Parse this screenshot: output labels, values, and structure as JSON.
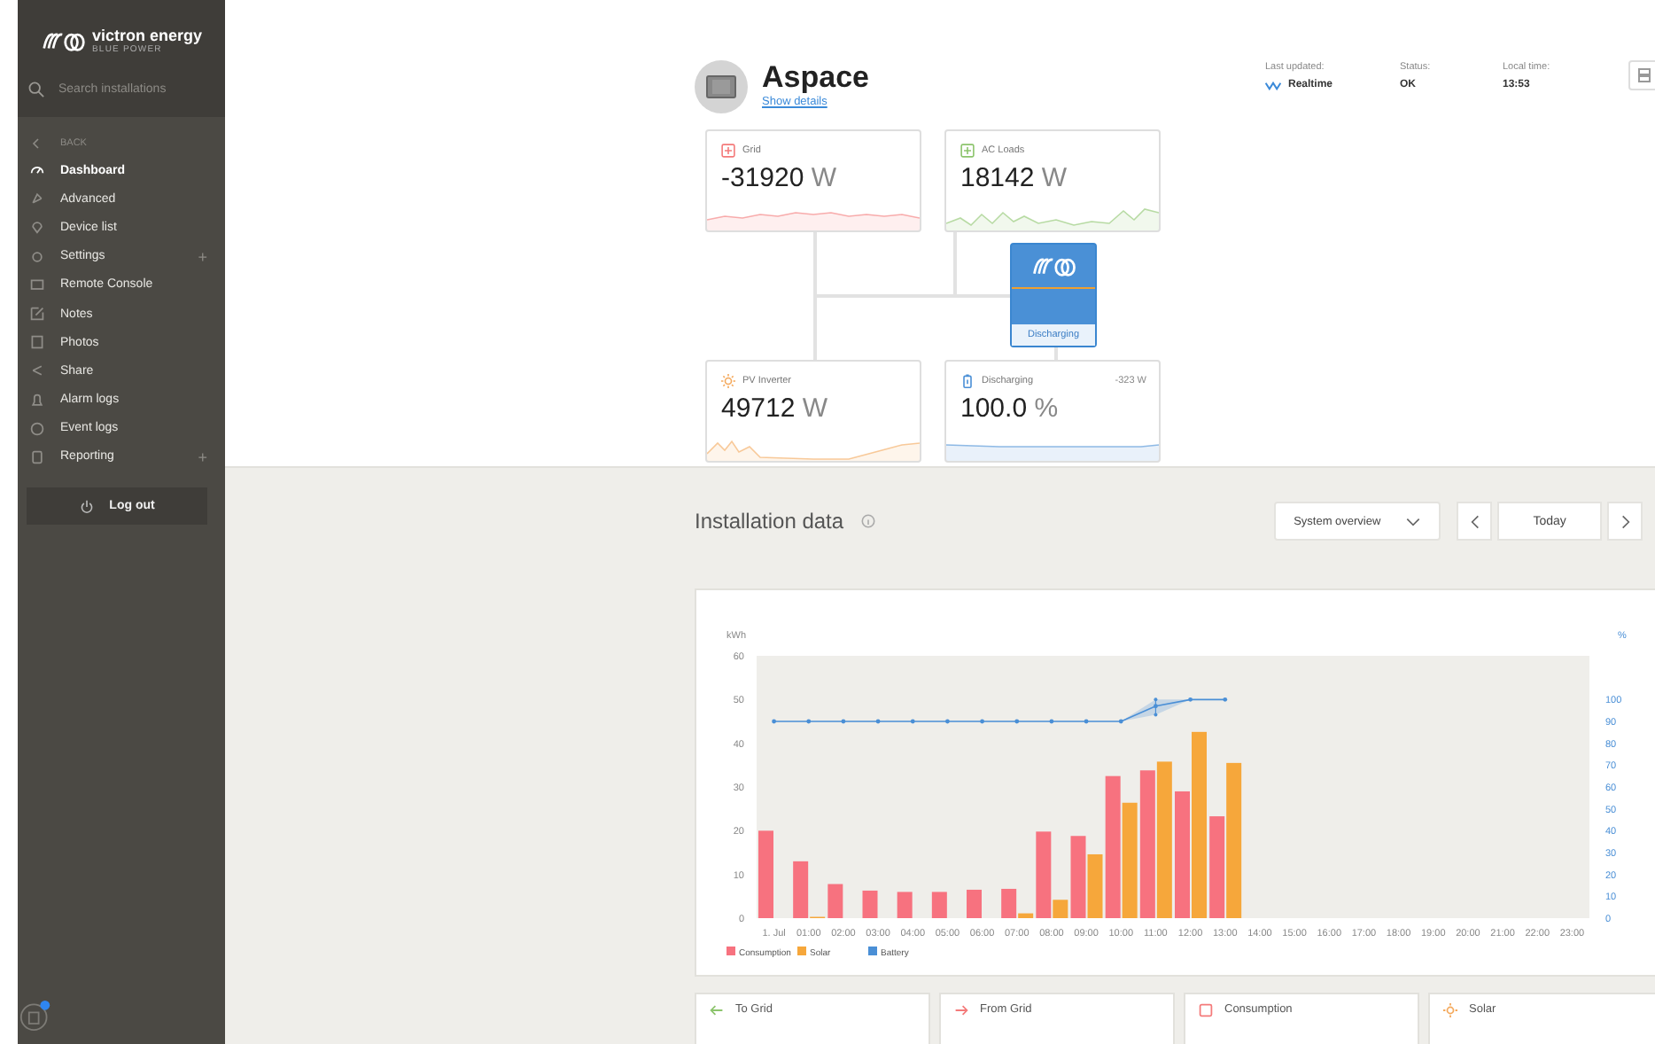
{
  "sidebar": {
    "logo": "victron energy",
    "tagline": "BLUE POWER",
    "search": {
      "placeholder": "Search installations"
    },
    "back": "BACK",
    "items": [
      {
        "label": "Dashboard",
        "selected": true,
        "expandable": false
      },
      {
        "label": "Advanced",
        "selected": false,
        "expandable": false
      },
      {
        "label": "Device list",
        "selected": false,
        "expandable": false
      },
      {
        "label": "Settings",
        "selected": false,
        "expandable": true
      },
      {
        "label": "Remote Console",
        "selected": false,
        "expandable": false
      },
      {
        "label": "Notes",
        "selected": false,
        "expandable": false
      },
      {
        "label": "Photos",
        "selected": false,
        "expandable": false
      },
      {
        "label": "Share",
        "selected": false,
        "expandable": false
      },
      {
        "label": "Alarm logs",
        "selected": false,
        "expandable": false
      },
      {
        "label": "Event logs",
        "selected": false,
        "expandable": false
      },
      {
        "label": "Reporting",
        "selected": false,
        "expandable": true
      }
    ],
    "expand_mark": "+",
    "logout": "Log out"
  },
  "header": {
    "title": "Aspace",
    "details_link": "Show details",
    "stats": [
      {
        "label": "Last updated:",
        "value": "Realtime",
        "live": true
      },
      {
        "label": "Status:",
        "value": "OK",
        "live": false
      },
      {
        "label": "Local time:",
        "value": "13:53",
        "live": false
      }
    ]
  },
  "flow": {
    "tiles": [
      {
        "kind": "grid",
        "label": "Grid",
        "value": "-31920",
        "unit": "W"
      },
      {
        "kind": "loads",
        "label": "AC Loads",
        "value": "18142",
        "unit": "W"
      },
      {
        "kind": "pv",
        "label": "PV Inverter",
        "value": "49712",
        "unit": "W"
      },
      {
        "kind": "battery",
        "label": "Discharging",
        "value": "100.0",
        "unit": "%",
        "power": "-323 W"
      }
    ],
    "inverter_state": "Discharging"
  },
  "installation_data": {
    "title": "Installation data",
    "view": "System overview",
    "period": "Today",
    "chart_data": {
      "type": "bar",
      "ylabel": "kWh",
      "ylim": [
        0,
        60
      ],
      "yticks": [
        0,
        10,
        20,
        30,
        40,
        50,
        60
      ],
      "legend": "lower left",
      "categories": [
        "1. Jul",
        "01:00",
        "02:00",
        "03:00",
        "04:00",
        "05:00",
        "06:00",
        "07:00",
        "08:00",
        "09:00",
        "10:00",
        "11:00",
        "12:00",
        "13:00",
        "14:00",
        "15:00",
        "16:00",
        "17:00",
        "18:00",
        "19:00",
        "20:00",
        "21:00",
        "22:00",
        "23:00"
      ],
      "series": [
        {
          "name": "Consumption",
          "color": "#f7727f",
          "values": [
            20,
            13,
            7.8,
            6.3,
            6,
            6,
            6.5,
            6.7,
            19.8,
            18.8,
            32.5,
            33.8,
            29,
            23.3,
            null,
            null,
            null,
            null,
            null,
            null,
            null,
            null,
            null,
            null
          ]
        },
        {
          "name": "Solar",
          "color": "#f6a73b",
          "values": [
            0,
            0.3,
            0,
            0,
            0,
            0,
            0,
            1.1,
            4.2,
            14.6,
            26.4,
            35.8,
            42.6,
            35.5,
            null,
            null,
            null,
            null,
            null,
            null,
            null,
            null,
            null,
            null
          ]
        }
      ]
    },
    "battery": {
      "chart_data": {
        "type": "line",
        "ylabel": "%",
        "ylim": [
          0,
          120
        ],
        "yticks": [
          0,
          10,
          20,
          30,
          40,
          50,
          60,
          70,
          80,
          90,
          100
        ],
        "series": [
          {
            "name": "Battery",
            "color": "#4a8fd6",
            "values": [
              90,
              90,
              90,
              90,
              90,
              90,
              90,
              90,
              90,
              90,
              90,
              97,
              100,
              100,
              null,
              null,
              null,
              null,
              null,
              null,
              null,
              null,
              null,
              null
            ],
            "errors": [
              null,
              null,
              null,
              null,
              null,
              null,
              null,
              null,
              null,
              null,
              null,
              [
                93,
                100
              ],
              null,
              null,
              null,
              null,
              null,
              null,
              null,
              null,
              null,
              null,
              null,
              null
            ]
          }
        ]
      }
    }
  },
  "summary_cards": [
    {
      "kind": "to_grid",
      "label": "To Grid"
    },
    {
      "kind": "from_grid",
      "label": "From Grid"
    },
    {
      "kind": "consumption",
      "label": "Consumption"
    },
    {
      "kind": "solar",
      "label": "Solar"
    }
  ]
}
